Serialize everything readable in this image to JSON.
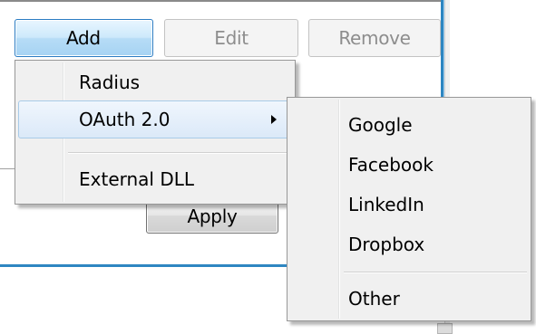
{
  "toolbar": {
    "add_label": "Add",
    "edit_label": "Edit",
    "remove_label": "Remove",
    "apply_label": "Apply"
  },
  "add_menu": {
    "items": [
      {
        "label": "Radius"
      },
      {
        "label": "OAuth 2.0",
        "has_submenu": true,
        "highlighted": true
      },
      {
        "label": "External DLL"
      }
    ]
  },
  "oauth_submenu": {
    "items": [
      {
        "label": "Google"
      },
      {
        "label": "Facebook"
      },
      {
        "label": "LinkedIn"
      },
      {
        "label": "Dropbox"
      },
      {
        "label": "Other"
      }
    ]
  },
  "colors": {
    "accent": "#2e86c1",
    "menu_bg": "#f0f0f0",
    "highlight": "#dbe9f8",
    "disabled_text": "#8d8d8d"
  },
  "icons": {
    "submenu": "chevron-right-icon"
  }
}
